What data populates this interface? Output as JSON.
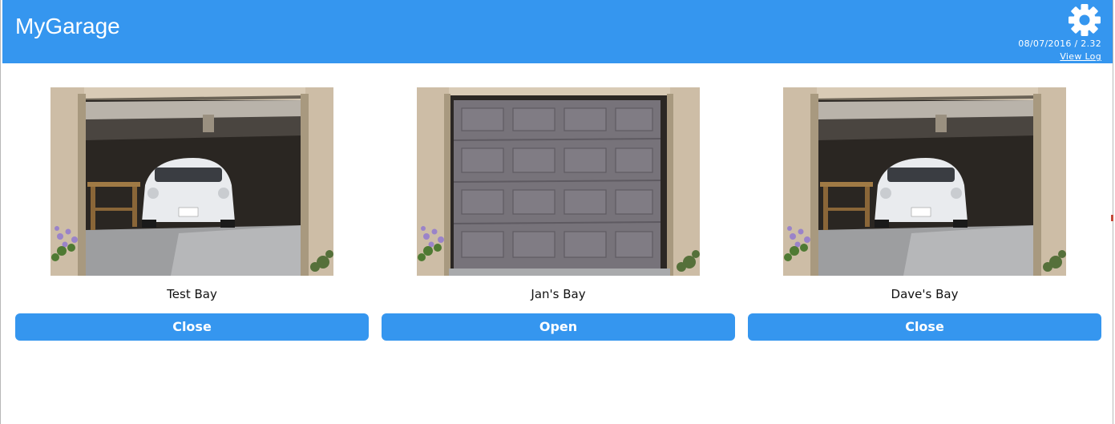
{
  "header": {
    "title": "MyGarage",
    "timestamp": "08/07/2016 / 2.32",
    "view_log_label": "View Log",
    "settings_icon": "gear-icon",
    "background": "#3596ef"
  },
  "bays": [
    {
      "name": "Test Bay",
      "state": "open",
      "button_label": "Close"
    },
    {
      "name": "Jan's Bay",
      "state": "closed",
      "button_label": "Open"
    },
    {
      "name": "Dave's Bay",
      "state": "open",
      "button_label": "Close"
    }
  ],
  "colors": {
    "accent": "#3596ef",
    "button_text": "#ffffff"
  }
}
